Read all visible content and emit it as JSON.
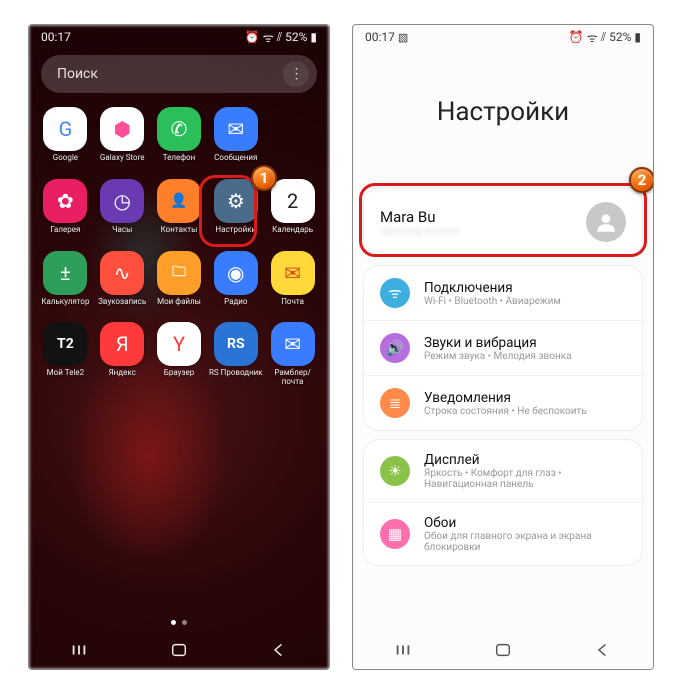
{
  "statusbar": {
    "time": "00:17",
    "battery": "52%"
  },
  "left": {
    "search_placeholder": "Поиск",
    "apps": [
      {
        "label": "Google",
        "bg": "#ffffff",
        "glyph": "G",
        "fg": "#4285f4"
      },
      {
        "label": "Galaxy Store",
        "bg": "#ffffff",
        "glyph": "⬢",
        "fg": "#ff4f9b"
      },
      {
        "label": "Телефон",
        "bg": "#2bbf5a",
        "glyph": "✆",
        "fg": "#fff"
      },
      {
        "label": "Сообщения",
        "bg": "#3a7cff",
        "glyph": "✉",
        "fg": "#fff"
      },
      {
        "label": "",
        "bg": "transparent",
        "glyph": "",
        "fg": "#fff"
      },
      {
        "label": "Галерея",
        "bg": "#e91e63",
        "glyph": "✿",
        "fg": "#fff"
      },
      {
        "label": "Часы",
        "bg": "#6a3ab2",
        "glyph": "◷",
        "fg": "#fff"
      },
      {
        "label": "Контакты",
        "bg": "#ff7f2a",
        "glyph": "👤",
        "fg": "#fff"
      },
      {
        "label": "Настройки",
        "bg": "#4a6b8a",
        "glyph": "⚙",
        "fg": "#fff"
      },
      {
        "label": "Календарь",
        "bg": "#ffffff",
        "glyph": "2",
        "fg": "#222"
      },
      {
        "label": "Калькулятор",
        "bg": "#2e9e5b",
        "glyph": "±",
        "fg": "#fff"
      },
      {
        "label": "Звукозапись",
        "bg": "#ff4f3f",
        "glyph": "∿",
        "fg": "#fff"
      },
      {
        "label": "Мои файлы",
        "bg": "#ff9f2a",
        "glyph": "🗀",
        "fg": "#fff"
      },
      {
        "label": "Радио",
        "bg": "#3a7cff",
        "glyph": "◉",
        "fg": "#fff"
      },
      {
        "label": "Почта",
        "bg": "#ffd93a",
        "glyph": "✉",
        "fg": "#d24a1a"
      },
      {
        "label": "Мой Tele2",
        "bg": "#121212",
        "glyph": "T2",
        "fg": "#fff"
      },
      {
        "label": "Яндекс",
        "bg": "#ff3a3a",
        "glyph": "Я",
        "fg": "#fff"
      },
      {
        "label": "Браузер",
        "bg": "#ffffff",
        "glyph": "Y",
        "fg": "#ff3a3a"
      },
      {
        "label": "RS Проводник",
        "bg": "#2a74d6",
        "glyph": "RS",
        "fg": "#fff"
      },
      {
        "label": "Рамблер/\nпочта",
        "bg": "#3a7cff",
        "glyph": "✉",
        "fg": "#fff"
      }
    ],
    "annotation_1": "1"
  },
  "right": {
    "header": "Настройки",
    "account": {
      "name": "Mara Bu",
      "sub": "samsung account"
    },
    "annotation_2": "2",
    "items": [
      {
        "title": "Подключения",
        "sub": "Wi-Fi • Bluetooth • Авиарежим",
        "bg": "#3daee0",
        "glyph": "ᯤ"
      },
      {
        "title": "Звуки и вибрация",
        "sub": "Режим звука • Мелодия звонка",
        "bg": "#b66de0",
        "glyph": "🔊"
      },
      {
        "title": "Уведомления",
        "sub": "Строка состояния • Не беспокоить",
        "bg": "#ff8a4a",
        "glyph": "≣"
      },
      {
        "title": "Дисплей",
        "sub": "Яркость • Комфорт для глаз • Навигационная панель",
        "bg": "#8bc34a",
        "glyph": "☀"
      },
      {
        "title": "Обои",
        "sub": "Обои для главного экрана и экрана блокировки",
        "bg": "#ff6fae",
        "glyph": "▦"
      }
    ]
  }
}
